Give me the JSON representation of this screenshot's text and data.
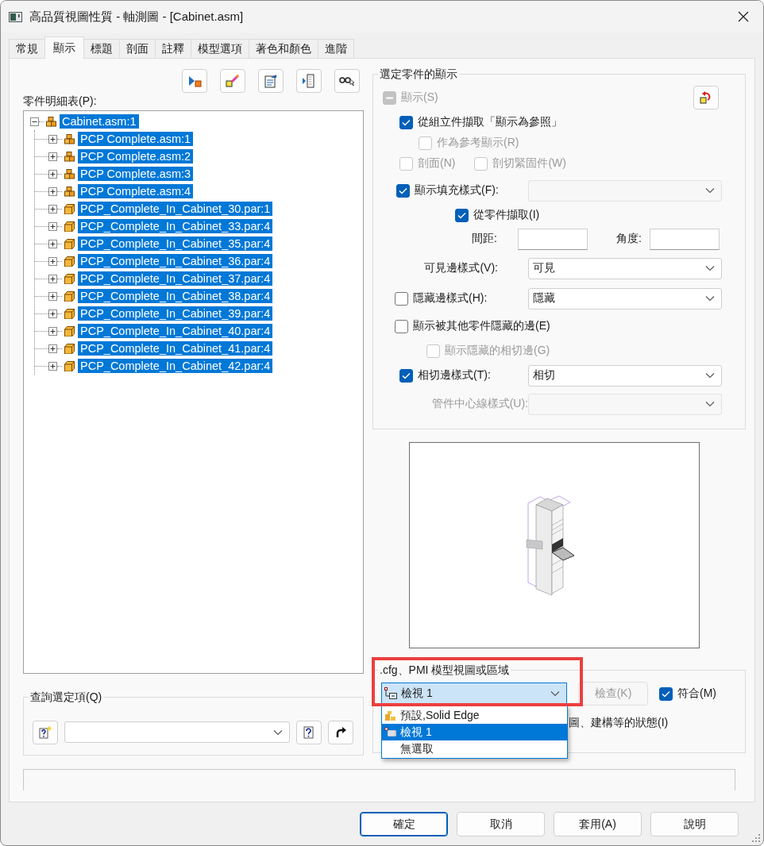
{
  "window": {
    "title": "高品質視圖性質 - 軸測圖 - [Cabinet.asm]"
  },
  "tabs": [
    {
      "label": "常規",
      "selected": false
    },
    {
      "label": "顯示",
      "selected": true
    },
    {
      "label": "標題",
      "selected": false
    },
    {
      "label": "剖面",
      "selected": false
    },
    {
      "label": "註釋",
      "selected": false
    },
    {
      "label": "模型選項",
      "selected": false
    },
    {
      "label": "著色和顏色",
      "selected": false
    },
    {
      "label": "進階",
      "selected": false
    }
  ],
  "parts_list": {
    "label": "零件明細表(P):",
    "tree": [
      {
        "label": "Cabinet.asm:1",
        "kind": "assembly",
        "expanded": true,
        "selected": true,
        "children": [
          {
            "label": "PCP Complete.asm:1",
            "kind": "assembly",
            "expanded": false,
            "selected": true
          },
          {
            "label": "PCP Complete.asm:2",
            "kind": "assembly",
            "expanded": false,
            "selected": true
          },
          {
            "label": "PCP Complete.asm:3",
            "kind": "assembly",
            "expanded": false,
            "selected": true
          },
          {
            "label": "PCP Complete.asm:4",
            "kind": "assembly",
            "expanded": false,
            "selected": true
          },
          {
            "label": "PCP_Complete_In_Cabinet_30.par:1",
            "kind": "part",
            "expanded": false,
            "selected": true
          },
          {
            "label": "PCP_Complete_In_Cabinet_33.par:4",
            "kind": "part",
            "expanded": false,
            "selected": true
          },
          {
            "label": "PCP_Complete_In_Cabinet_35.par:4",
            "kind": "part",
            "expanded": false,
            "selected": true
          },
          {
            "label": "PCP_Complete_In_Cabinet_36.par:4",
            "kind": "part",
            "expanded": false,
            "selected": true
          },
          {
            "label": "PCP_Complete_In_Cabinet_37.par:4",
            "kind": "part",
            "expanded": false,
            "selected": true
          },
          {
            "label": "PCP_Complete_In_Cabinet_38.par:4",
            "kind": "part",
            "expanded": false,
            "selected": true
          },
          {
            "label": "PCP_Complete_In_Cabinet_39.par:4",
            "kind": "part",
            "expanded": false,
            "selected": true
          },
          {
            "label": "PCP_Complete_In_Cabinet_40.par:4",
            "kind": "part",
            "expanded": false,
            "selected": true
          },
          {
            "label": "PCP_Complete_In_Cabinet_41.par:4",
            "kind": "part",
            "expanded": false,
            "selected": true
          },
          {
            "label": "PCP_Complete_In_Cabinet_42.par:4",
            "kind": "part",
            "expanded": false,
            "selected": true
          }
        ]
      }
    ]
  },
  "query": {
    "title": "查詢選定項(Q)"
  },
  "selected_part_display": {
    "title": "選定零件的顯示",
    "show": {
      "label": "顯示(S)",
      "indeterminate": true,
      "disabled": true
    },
    "from_assembly": {
      "label": "從組立件擷取「顯示為參照」",
      "checked": true,
      "disabled": false
    },
    "as_reference": {
      "label": "作為參考顯示(R)",
      "checked": false,
      "disabled": true
    },
    "section": {
      "label": "剖面(N)",
      "checked": false,
      "disabled": true
    },
    "section_fasteners": {
      "label": "剖切緊固件(W)",
      "checked": false,
      "disabled": true
    },
    "fill_style": {
      "label": "顯示填充樣式(F):",
      "checked": true,
      "disabled": false,
      "select_disabled": true
    },
    "from_part": {
      "label": "從零件擷取(I)",
      "checked": true,
      "disabled": false
    },
    "spacing": {
      "label": "間距:"
    },
    "angle": {
      "label": "角度:"
    },
    "visible_edge_style": {
      "label": "可見邊樣式(V):",
      "value": "可見"
    },
    "hidden_edge_style": {
      "label": "隱藏邊樣式(H):",
      "checked": false,
      "disabled": false,
      "value": "隱藏"
    },
    "hidden_by_other_parts": {
      "label": "顯示被其他零件隱藏的邊(E)",
      "checked": false,
      "disabled": false
    },
    "hidden_tangent_edges": {
      "label": "顯示隱藏的相切邊(G)",
      "checked": false,
      "disabled": true
    },
    "tangent_edge_style": {
      "label": "相切邊樣式(T):",
      "checked": true,
      "disabled": false,
      "value": "相切"
    },
    "tube_centerline_style": {
      "label": "管件中心線樣式(U):",
      "disabled": true
    }
  },
  "model_view": {
    "title": ".cfg、PMI 模型視圖或區域",
    "value": "檢視 1",
    "options": [
      {
        "label": "預設,Solid Edge",
        "kind": "default",
        "selected": false
      },
      {
        "label": "檢視 1",
        "kind": "view",
        "selected": true
      },
      {
        "label": "無選取",
        "kind": "none",
        "selected": false
      }
    ],
    "check_button": {
      "label": "檢查(K)",
      "disabled": true
    },
    "match": {
      "label": "符合(M)",
      "checked": true,
      "disabled": false
    },
    "state_option_partial": "圖、建構等的狀態(I)"
  },
  "buttons": [
    {
      "label": "確定",
      "default": true
    },
    {
      "label": "取消",
      "default": false
    },
    {
      "label": "套用(A)",
      "default": false
    },
    {
      "label": "說明",
      "default": false
    }
  ]
}
